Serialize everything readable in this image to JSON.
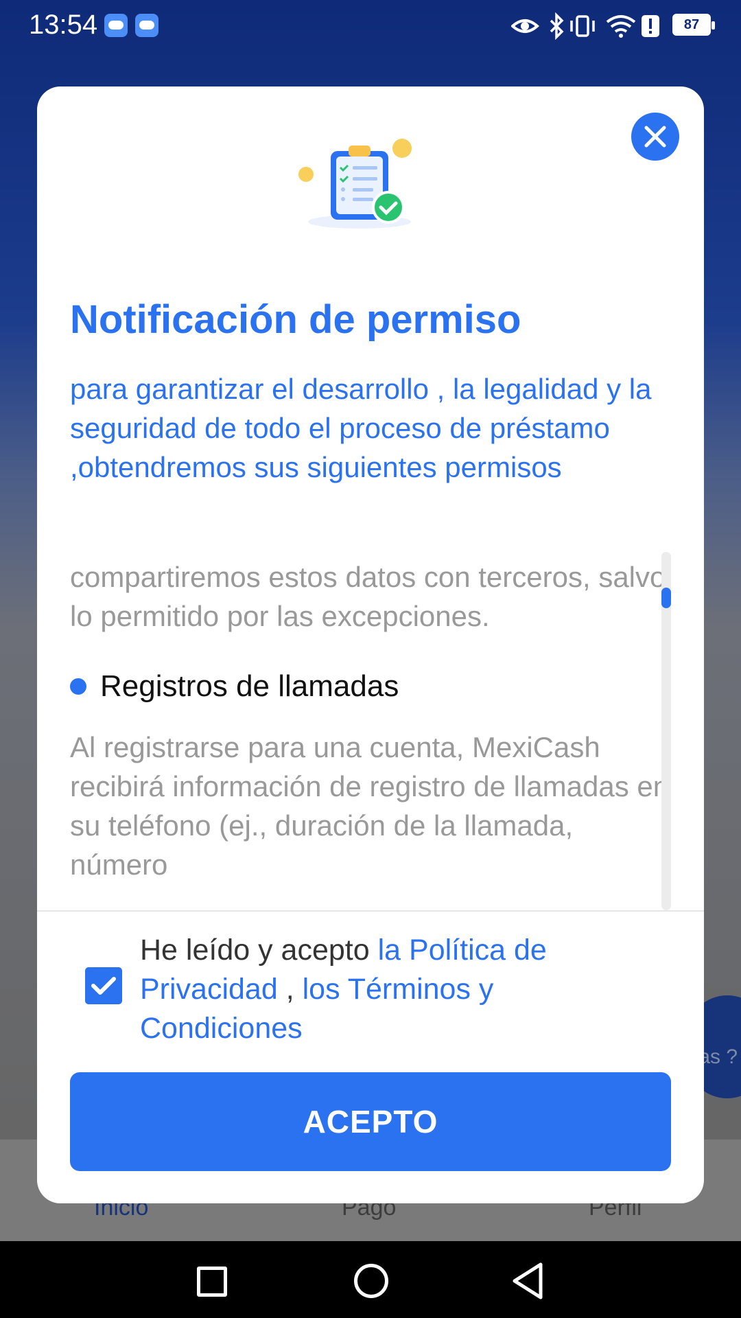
{
  "status_bar": {
    "time": "13:54",
    "battery": "87"
  },
  "dialog": {
    "title": "Notificación de permiso",
    "intro": "para garantizar el desarrollo , la legalidad y la seguridad de todo el proceso de préstamo ,obtendremos sus siguientes permisos",
    "scroll_content": {
      "paragraph_top": "compartiremos estos datos con terceros, salvo lo permitido por las excepciones.",
      "bullet_title": "Registros de llamadas",
      "bullet_text": "Al registrarse para una cuenta, MexiCash recibirá información de registro de llamadas en su teléfono (ej., duración de la llamada, número"
    },
    "consent": {
      "prefix": "He leído y acepto ",
      "link_privacy": "la Política de Privacidad",
      "separator": " , ",
      "link_terms": "los Términos y Condiciones",
      "checked": true
    },
    "accept_button": "ACEPTO"
  },
  "background_app": {
    "tabs": [
      {
        "label": "Inicio",
        "active": true
      },
      {
        "label": "Pago",
        "active": false
      },
      {
        "label": "Perfil",
        "active": false
      }
    ],
    "fab_text": "tas ?"
  },
  "nav_bar": {
    "buttons": [
      "recents-icon",
      "home-icon",
      "back-icon"
    ]
  },
  "colors": {
    "accent": "#2b72f0",
    "header_bg": "#0e2a78"
  }
}
